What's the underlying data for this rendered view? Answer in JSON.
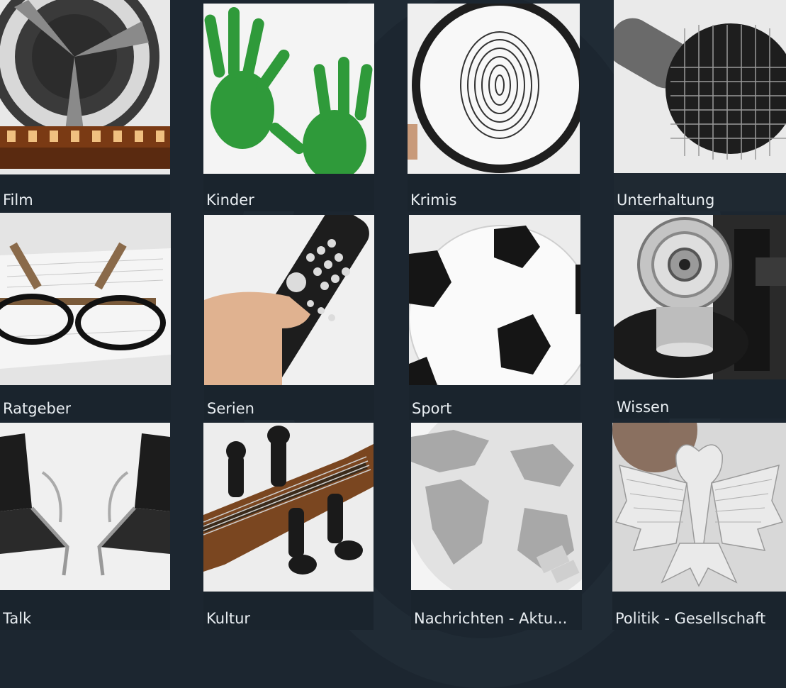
{
  "categories": [
    {
      "label": "Film",
      "icon": "film-reel-icon"
    },
    {
      "label": "Kinder",
      "icon": "handprint-icon"
    },
    {
      "label": "Krimis",
      "icon": "fingerprint-magnifier-icon"
    },
    {
      "label": "Unterhaltung",
      "icon": "microphone-icon"
    },
    {
      "label": "Ratgeber",
      "icon": "glasses-book-icon"
    },
    {
      "label": "Serien",
      "icon": "remote-control-icon"
    },
    {
      "label": "Sport",
      "icon": "soccer-ball-icon"
    },
    {
      "label": "Wissen",
      "icon": "microscope-icon"
    },
    {
      "label": "Talk",
      "icon": "chairs-icon"
    },
    {
      "label": "Kultur",
      "icon": "violin-icon"
    },
    {
      "label": "Nachrichten - Aktu...",
      "icon": "globe-icon"
    },
    {
      "label": "Politik - Gesellschaft",
      "icon": "federal-eagle-icon"
    }
  ]
}
